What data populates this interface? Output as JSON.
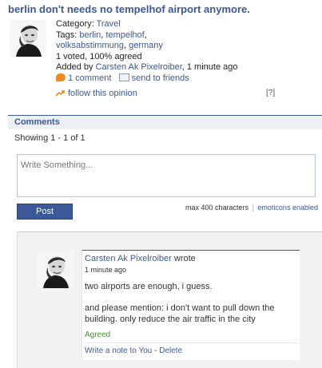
{
  "opinion": {
    "title": "berlin don't needs no tempelhof airport anymore.",
    "category_label": "Category:",
    "category_value": "Travel",
    "tags_label": "Tags:",
    "tags": [
      "berlin",
      "tempelhof",
      "volksabstimmung",
      "germany"
    ],
    "tags_seps": [
      ",",
      ",",
      ","
    ],
    "votes_text": "1 voted, 100% agreed",
    "added_by_label": "Added by",
    "added_by_user": "Carsten Ak Pixelroiber",
    "added_time": ", 1 minute ago",
    "comment_count_link": "1 comment",
    "send_to_friends": "send to friends",
    "follow": "follow this opinion",
    "help": "[?]"
  },
  "comments": {
    "header": "Comments",
    "showing": "Showing 1 - 1 of 1",
    "input_placeholder": "Write Something...",
    "post_button": "Post",
    "max_chars": "max 400 characters",
    "separator": "|",
    "emoticons": "emoticons enabled",
    "items": [
      {
        "author": "Carsten Ak Pixelroiber",
        "wrote": " wrote",
        "time": "1 minute ago",
        "line1": "two airports are enough, i guess.",
        "line2": "and please mention: i don't want to pull down the building. only reduce the air traffic in the city",
        "status": "Agreed",
        "write_note": "Write a note to You",
        "dash": " - ",
        "delete": "Delete"
      }
    ]
  },
  "colors": {
    "brand": "#3b5998",
    "agreed": "#3a9a22",
    "comment_icon": "#f08a24"
  },
  "icons": [
    "user-avatar",
    "comment-icon",
    "send-icon",
    "follow-icon"
  ]
}
